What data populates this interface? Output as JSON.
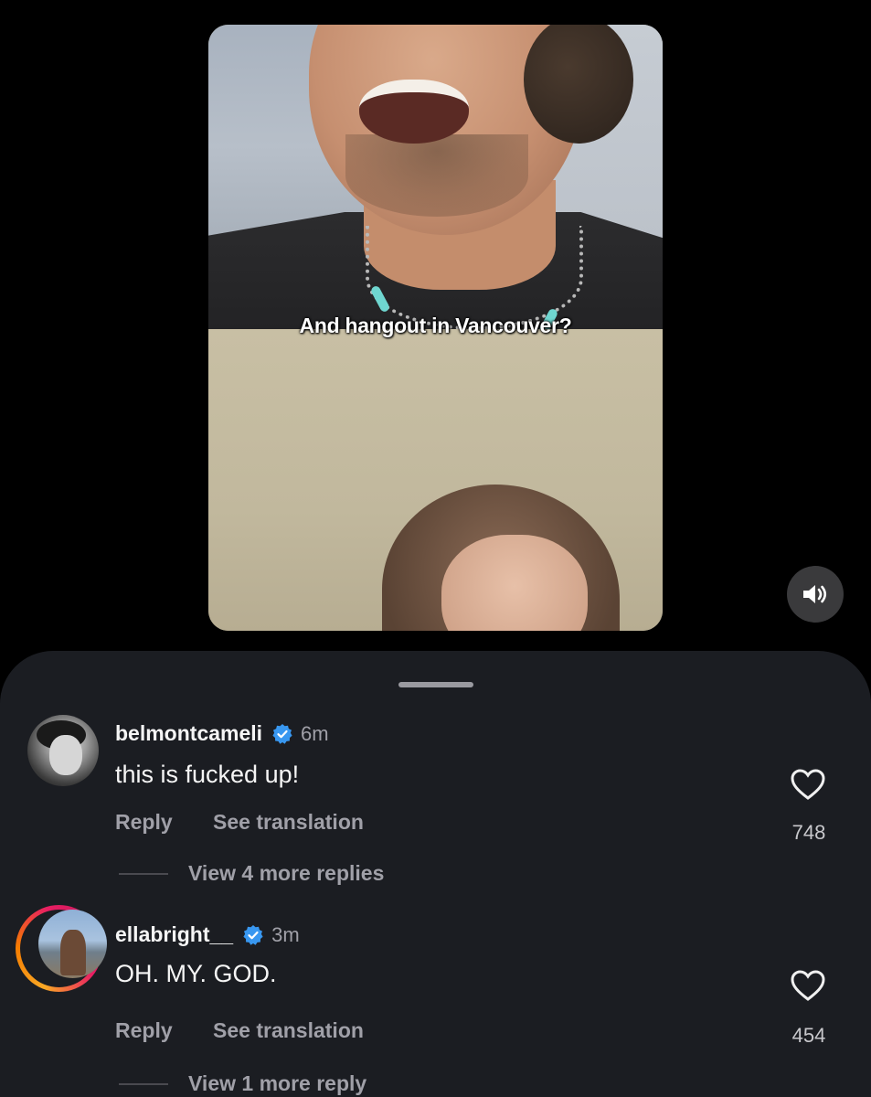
{
  "video": {
    "caption": "And hangout in Vancouver?",
    "volume_icon": "speaker-on-icon"
  },
  "comments": [
    {
      "username": "belmontcameli",
      "verified": true,
      "time": "6m",
      "text": "this is fucked up!",
      "reply_label": "Reply",
      "translate_label": "See translation",
      "likes": "748",
      "view_replies": "View 4 more replies"
    },
    {
      "username": "ellabright__",
      "verified": true,
      "has_story": true,
      "time": "3m",
      "text": "OH. MY. GOD.",
      "reply_label": "Reply",
      "translate_label": "See translation",
      "likes": "454",
      "view_replies": "View 1 more reply"
    }
  ],
  "colors": {
    "sheet_bg": "#1b1d22",
    "verified_blue": "#3897f0"
  }
}
